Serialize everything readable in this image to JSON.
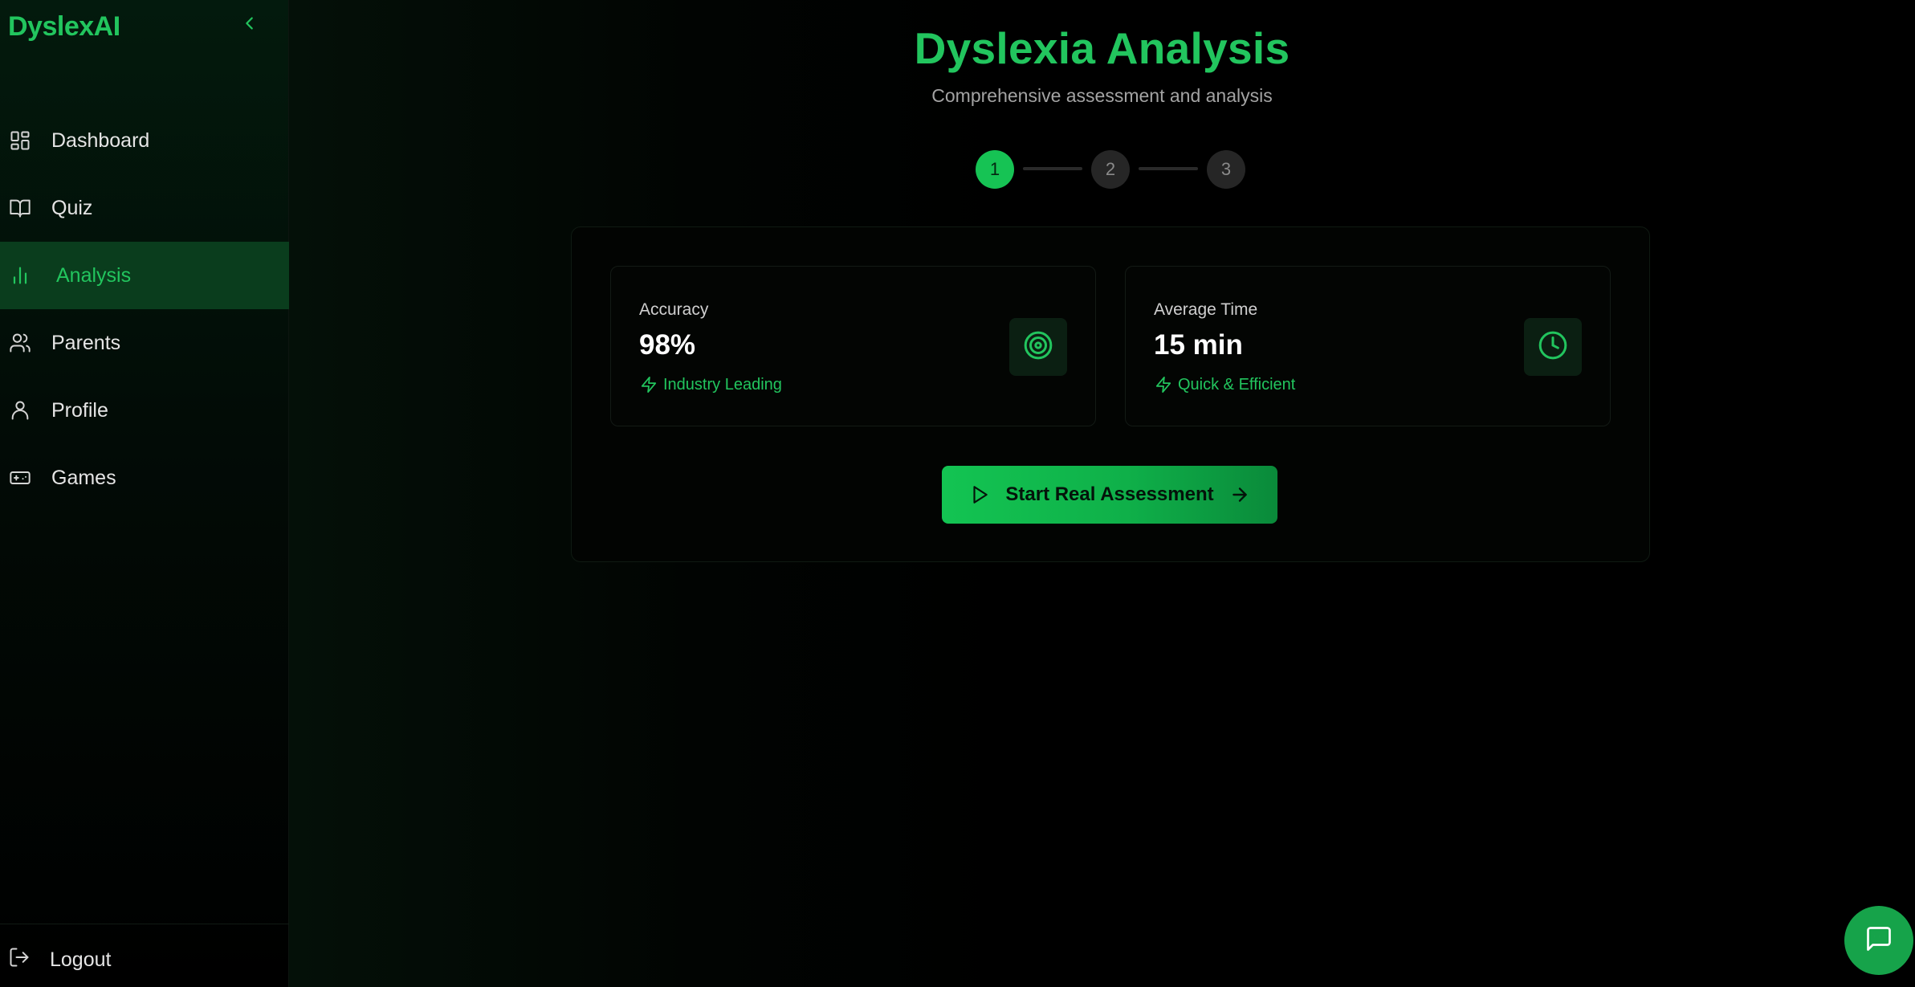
{
  "brand": "DyslexAI",
  "colors": {
    "accent": "#22c55e",
    "active_bg": "#0a3d1d",
    "background": "#000000"
  },
  "sidebar": {
    "collapse_icon": "chevron-left-icon",
    "items": [
      {
        "label": "Dashboard",
        "icon": "layout-grid-icon",
        "active": false
      },
      {
        "label": "Quiz",
        "icon": "book-open-icon",
        "active": false
      },
      {
        "label": "Analysis",
        "icon": "bar-chart-icon",
        "active": true
      },
      {
        "label": "Parents",
        "icon": "users-icon",
        "active": false
      },
      {
        "label": "Profile",
        "icon": "user-icon",
        "active": false
      },
      {
        "label": "Games",
        "icon": "gamepad-icon",
        "active": false
      }
    ],
    "logout": {
      "label": "Logout",
      "icon": "logout-icon"
    }
  },
  "main": {
    "title": "Dyslexia Analysis",
    "subtitle": "Comprehensive assessment and analysis",
    "steps": [
      {
        "label": "1",
        "state": "current"
      },
      {
        "label": "2",
        "state": "upcoming"
      },
      {
        "label": "3",
        "state": "upcoming"
      }
    ],
    "stats": [
      {
        "label": "Accuracy",
        "value": "98%",
        "note": "Industry Leading",
        "icon": "target-icon",
        "note_icon": "zap-icon"
      },
      {
        "label": "Average Time",
        "value": "15 min",
        "note": "Quick & Efficient",
        "icon": "clock-icon",
        "note_icon": "zap-icon"
      }
    ],
    "cta": {
      "label": "Start Real Assessment",
      "left_icon": "play-icon",
      "right_icon": "arrow-right-icon"
    }
  },
  "chat_button": {
    "icon": "message-square-icon"
  }
}
